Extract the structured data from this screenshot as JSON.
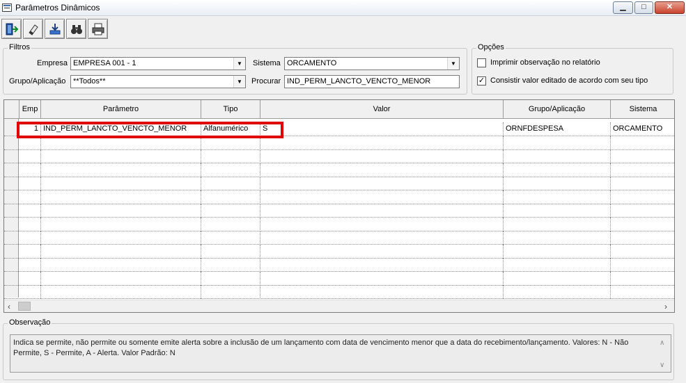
{
  "window": {
    "title": "Parâmetros Dinâmicos",
    "min_glyph": "▁",
    "max_glyph": "□",
    "close_glyph": "✕"
  },
  "toolbar": {
    "buttons": [
      {
        "icon": "exit-door-icon"
      },
      {
        "icon": "eraser-icon"
      },
      {
        "icon": "save-download-icon"
      },
      {
        "icon": "binoculars-icon"
      },
      {
        "icon": "printer-icon"
      }
    ]
  },
  "filters": {
    "group_label": "Filtros",
    "empresa_label": "Empresa",
    "empresa_value": "EMPRESA 001 - 1",
    "sistema_label": "Sistema",
    "sistema_value": "ORCAMENTO",
    "grupo_label": "Grupo/Aplicação",
    "grupo_value": "**Todos**",
    "procurar_label": "Procurar",
    "procurar_value": "IND_PERM_LANCTO_VENCTO_MENOR",
    "dropdown_glyph": "▼"
  },
  "options": {
    "group_label": "Opções",
    "imprimir_label": "Imprimir observação no relatório",
    "imprimir_checked": false,
    "consistir_label": "Consistir valor editado de acordo com seu tipo",
    "consistir_checked": true,
    "check_glyph": "✓"
  },
  "grid": {
    "columns": [
      "Emp",
      "Parâmetro",
      "Tipo",
      "Valor",
      "Grupo/Aplicação",
      "Sistema"
    ],
    "rows": [
      {
        "emp": "1",
        "parametro": "IND_PERM_LANCTO_VENCTO_MENOR",
        "tipo": "Alfanumérico",
        "valor": "S",
        "grupo": "ORNFDESPESA",
        "sistema": "ORCAMENTO"
      }
    ],
    "scroll_left": "‹",
    "scroll_right": "›"
  },
  "observacao": {
    "group_label": "Observação",
    "text": "Indica se permite, não permite ou somente emite alerta sobre a inclusão de um lançamento com data de vencimento menor que a data do recebimento/lançamento. Valores: N - Não Permite, S - Permite, A - Alerta. Valor Padrão: N",
    "scroll_up": "∧",
    "scroll_down": "∨"
  },
  "colors": {
    "highlight": "#e00000",
    "close_button": "#c9432c"
  }
}
